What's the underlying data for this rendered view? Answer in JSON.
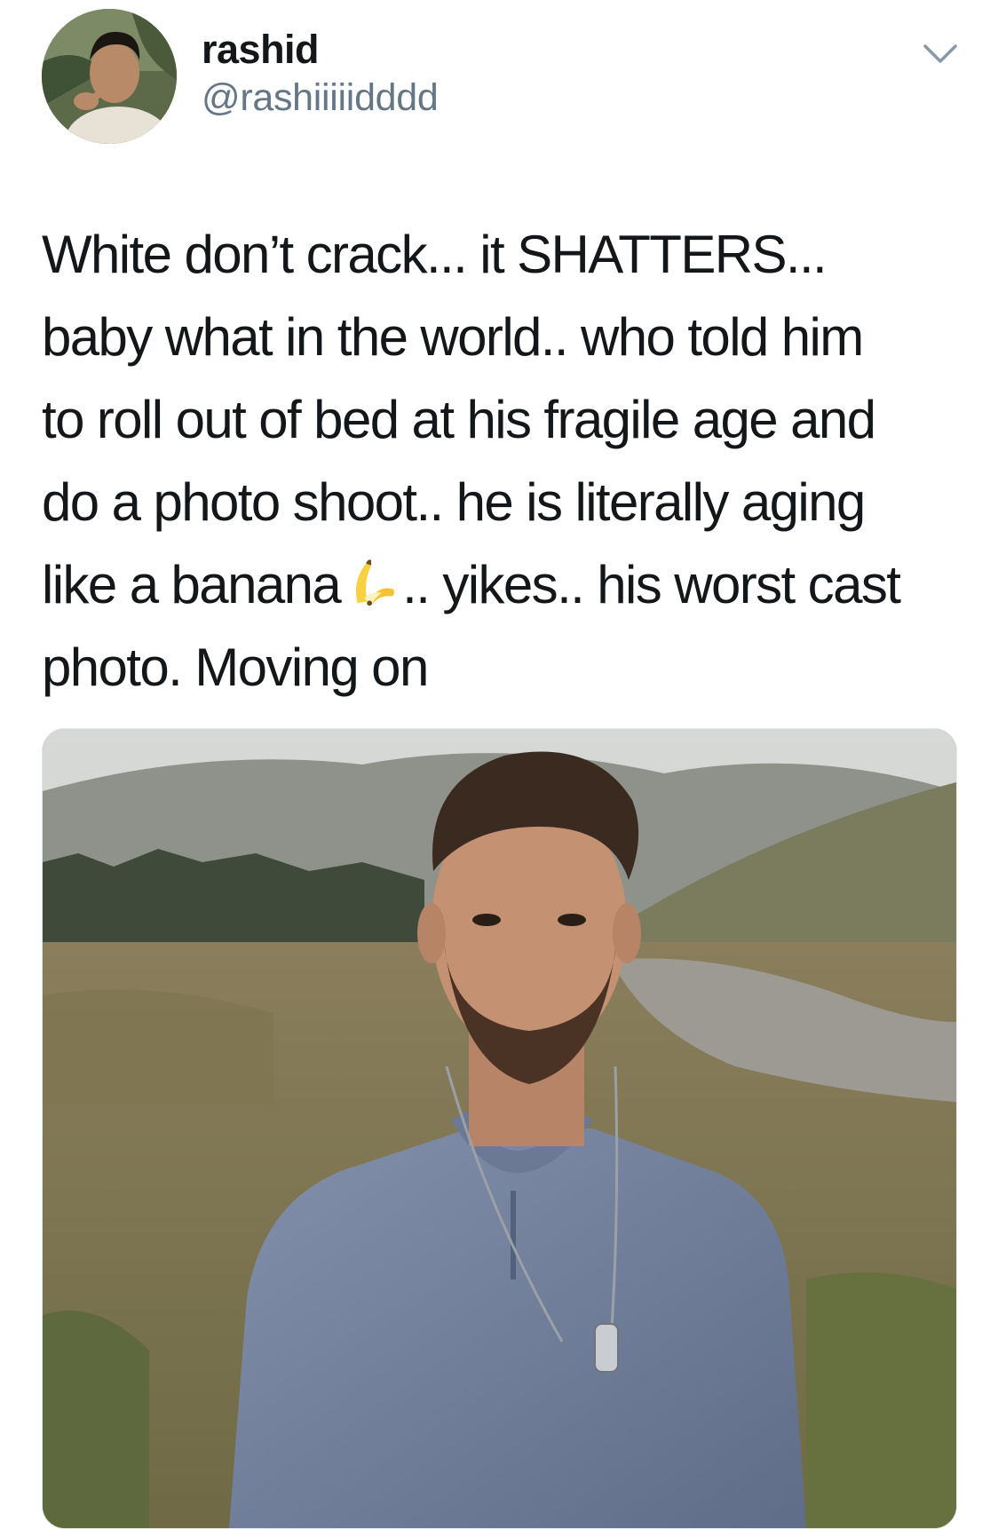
{
  "tweet": {
    "author": {
      "display_name": "rashid",
      "handle": "@rashiiiiidddd",
      "avatar_icon": "profile-photo"
    },
    "menu_icon": "chevron-down-icon",
    "text_lines": [
      "White don’t crack... it SHATTERS...",
      "baby what in the world.. who told him",
      "to roll out of bed at his fragile age and",
      "do a photo shoot.. he is literally aging",
      "like a banana",
      ".. yikes.. his worst cast",
      "photo. Moving on"
    ],
    "emoji": "🍌",
    "media": {
      "kind": "photo",
      "icon": "photo-icon"
    }
  },
  "colors": {
    "text": "#14171a",
    "secondary_text": "#657786",
    "border": "#e1e8ed",
    "chevron": "#8899a6"
  }
}
